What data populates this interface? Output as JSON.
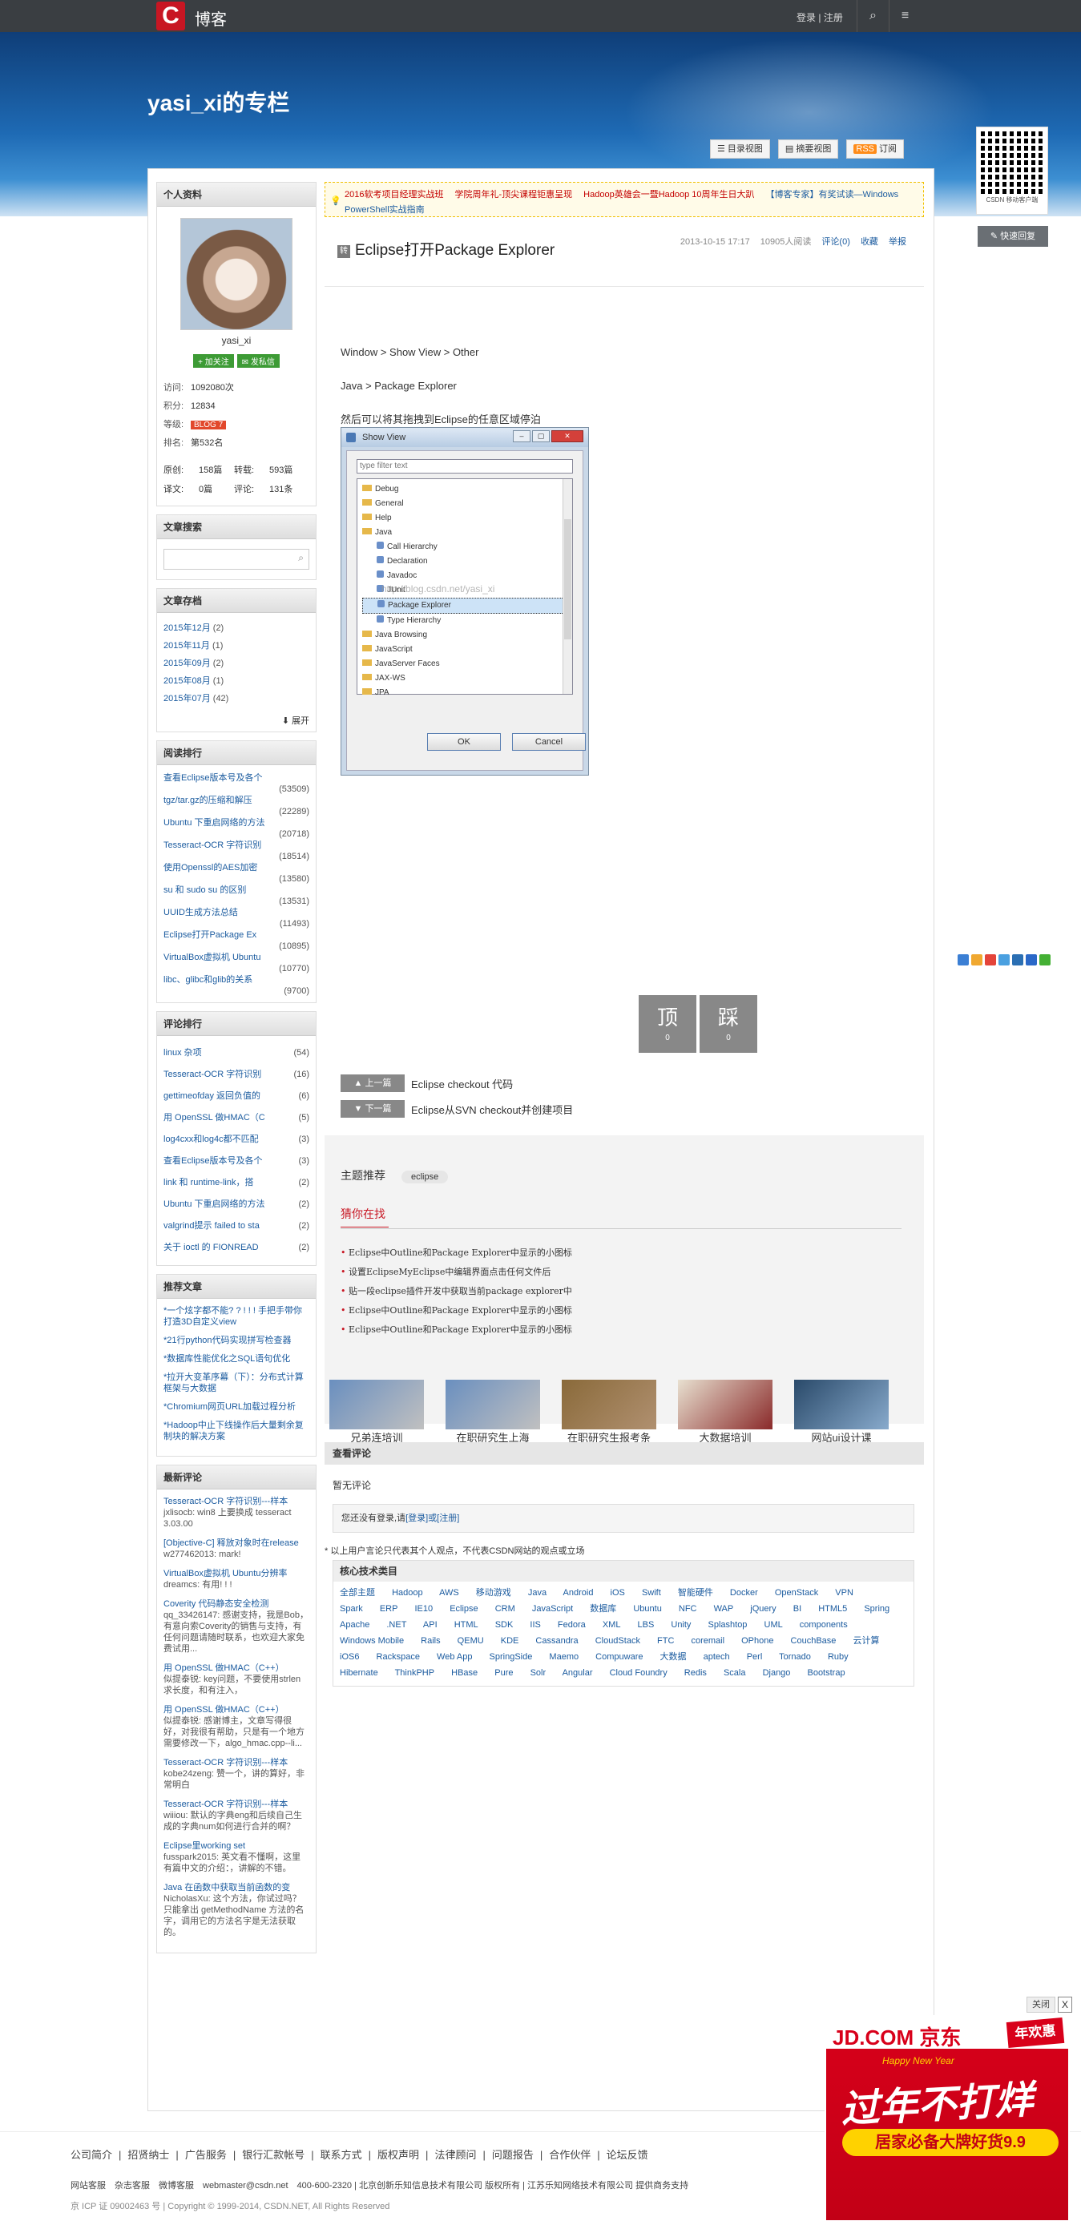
{
  "topbar": {
    "brand": "博客",
    "login": "登录",
    "sep": "|",
    "register": "注册"
  },
  "blog_title": "yasi_xi的专栏",
  "views": {
    "catalog": "目录视图",
    "summary": "摘要视图",
    "rss": "RSS",
    "subscribe": "订阅"
  },
  "qr_label": "CSDN 移动客户端",
  "quick_reply": "快速回复",
  "profile": {
    "heading": "个人资料",
    "name": "yasi_xi",
    "follow": "+ 加关注",
    "message": "✉ 发私信",
    "visits_label": "访问:",
    "visits": "1092080次",
    "points_label": "积分:",
    "points": "12834",
    "level_label": "等级:",
    "level": "BLOG 7",
    "rank_label": "排名:",
    "rank": "第532名",
    "orig_label": "原创:",
    "orig": "158篇",
    "repost_label": "转载:",
    "repost": "593篇",
    "trans_label": "译文:",
    "trans": "0篇",
    "comments_label": "评论:",
    "comments": "131条"
  },
  "search": {
    "heading": "文章搜索"
  },
  "archive": {
    "heading": "文章存档",
    "items": [
      {
        "m": "2015年12月",
        "c": "(2)"
      },
      {
        "m": "2015年11月",
        "c": "(1)"
      },
      {
        "m": "2015年09月",
        "c": "(2)"
      },
      {
        "m": "2015年08月",
        "c": "(1)"
      },
      {
        "m": "2015年07月",
        "c": "(42)"
      }
    ],
    "expand": "展开"
  },
  "read_rank": {
    "heading": "阅读排行",
    "items": [
      {
        "t": "查看Eclipse版本号及各个",
        "c": "(53509)"
      },
      {
        "t": "tgz/tar.gz的压缩和解压",
        "c": "(22289)"
      },
      {
        "t": "Ubuntu 下重启网络的方法",
        "c": "(20718)"
      },
      {
        "t": "Tesseract-OCR 字符识别",
        "c": "(18514)"
      },
      {
        "t": "使用Openssl的AES加密",
        "c": "(13580)"
      },
      {
        "t": "su 和 sudo su 的区别",
        "c": "(13531)"
      },
      {
        "t": "UUID生成方法总结",
        "c": "(11493)"
      },
      {
        "t": "Eclipse打开Package Ex",
        "c": "(10895)"
      },
      {
        "t": "VirtualBox虚拟机 Ubuntu",
        "c": "(10770)"
      },
      {
        "t": "libc、glibc和glib的关系",
        "c": "(9700)"
      }
    ]
  },
  "comment_rank": {
    "heading": "评论排行",
    "items": [
      {
        "t": "linux 杂项",
        "c": "(54)"
      },
      {
        "t": "Tesseract-OCR 字符识别",
        "c": "(16)"
      },
      {
        "t": "gettimeofday 返回负值的",
        "c": "(6)"
      },
      {
        "t": "用 OpenSSL 做HMAC（C",
        "c": "(5)"
      },
      {
        "t": "log4cxx和log4c都不匹配",
        "c": "(3)"
      },
      {
        "t": "查看Eclipse版本号及各个",
        "c": "(3)"
      },
      {
        "t": "link 和 runtime-link，搭",
        "c": "(2)"
      },
      {
        "t": "Ubuntu 下重启网络的方法",
        "c": "(2)"
      },
      {
        "t": "valgrind提示 failed to sta",
        "c": "(2)"
      },
      {
        "t": "关于 ioctl 的 FIONREAD",
        "c": "(2)"
      }
    ]
  },
  "recommend": {
    "heading": "推荐文章",
    "items": [
      "*一个炫字都不能? ? ! ! ! 手把手带你打造3D自定义view",
      "*21行python代码实现拼写检查器",
      "*数据库性能优化之SQL语句优化",
      "*拉开大变革序幕（下）：分布式计算框架与大数据",
      "*Chromium网页URL加载过程分析",
      "*Hadoop中止下线操作后大量剩余复制块的解决方案"
    ]
  },
  "latest_comments": {
    "heading": "最新评论",
    "items": [
      {
        "t": "Tesseract-OCR 字符识别---样本",
        "b": "jxlisocb: win8 上要换成 tesseract 3.03.00"
      },
      {
        "t": "[Objective-C] 释放对象时在release",
        "b": "w277462013: mark!"
      },
      {
        "t": "VirtualBox虚拟机 Ubuntu分辨率",
        "b": "dreamcs: 有用! ! !"
      },
      {
        "t": "Coverity 代码静态安全检测",
        "b": "qq_33426147: 感谢支持，我是Bob，有意向索Coverity的销售与支持，有任何问题请随时联系，也欢迎大家免费试用..."
      },
      {
        "t": "用 OpenSSL 做HMAC（C++）",
        "b": "似提泰锐: key问题，不要使用strlen求长度，和有注入，"
      },
      {
        "t": "用 OpenSSL 做HMAC（C++）",
        "b": "似提泰锐: 感谢博主，文章写得很好，对我很有帮助，只是有一个地方需要修改一下，algo_hmac.cpp--li..."
      },
      {
        "t": "Tesseract-OCR 字符识别---样本",
        "b": "kobe24zeng: 赞一个，讲的算好，非常明白"
      },
      {
        "t": "Tesseract-OCR 字符识别---样本",
        "b": "wiiiou: 默认的字典eng和后续自己生成的字典num如何进行合并的啊？"
      },
      {
        "t": "Eclipse里working set",
        "b": "fusspark2015: 英文看不懂啊，这里有篇中文的介绍：，讲解的不错。"
      },
      {
        "t": "Java 在函数中获取当前函数的变",
        "b": "NicholasXu: 这个方法，你试过吗？只能拿出 getMethodName 方法的名字，调用它的方法名字是无法获取的。"
      }
    ]
  },
  "notice": [
    {
      "t": "2016软考项目经理实战班",
      "blue": false
    },
    {
      "t": "学院周年礼-顶尖课程钜惠呈现",
      "blue": false
    },
    {
      "t": "Hadoop英雄会一暨Hadoop 10周年生日大趴",
      "blue": false
    },
    {
      "t": "【博客专家】有奖试读—Windows PowerShell实战指南",
      "blue": true
    }
  ],
  "article": {
    "zhuan": "转",
    "title": "Eclipse打开Package Explorer",
    "date": "2013-10-15 17:17",
    "reads": "10905人阅读",
    "comment": "评论(0)",
    "collect": "收藏",
    "report": "举报",
    "lines": [
      "Window > Show View > Other",
      "Java > Package Explorer",
      "然后可以将其拖拽到Eclipse的任意区域停泊"
    ]
  },
  "dialog": {
    "title": "Show View",
    "filter": "type filter text",
    "items": [
      {
        "t": "Debug",
        "k": "folder"
      },
      {
        "t": "General",
        "k": "folder"
      },
      {
        "t": "Help",
        "k": "folder"
      },
      {
        "t": "Java",
        "k": "folder"
      },
      {
        "t": "Call Hierarchy",
        "k": "leaf"
      },
      {
        "t": "Declaration",
        "k": "leaf"
      },
      {
        "t": "Javadoc",
        "k": "leaf"
      },
      {
        "t": "JUnit",
        "k": "leaf"
      },
      {
        "t": "Package Explorer",
        "k": "sel"
      },
      {
        "t": "Type Hierarchy",
        "k": "leaf"
      },
      {
        "t": "Java Browsing",
        "k": "folder"
      },
      {
        "t": "JavaScript",
        "k": "folder"
      },
      {
        "t": "JavaServer Faces",
        "k": "folder"
      },
      {
        "t": "JAX-WS",
        "k": "folder"
      },
      {
        "t": "JPA",
        "k": "folder"
      }
    ],
    "watermark": "http://blog.csdn.net/yasi_xi",
    "ok": "OK",
    "cancel": "Cancel"
  },
  "votes": {
    "up": "顶",
    "up_count": "0",
    "down": "踩",
    "down_count": "0"
  },
  "prev": {
    "label": "上一篇",
    "title": "Eclipse checkout 代码"
  },
  "next": {
    "label": "下一篇",
    "title": "Eclipse从SVN checkout并创建项目"
  },
  "topic": {
    "label": "主题推荐",
    "tag": "eclipse"
  },
  "guess": {
    "heading": "猜你在找",
    "items": [
      "Eclipse中Outline和Package Explorer中显示的小图标",
      "设置EclipseMyEclipse中编辑界面点击任何文件后",
      "贴一段eclipse插件开发中获取当前package explorer中",
      "Eclipse中Outline和Package Explorer中显示的小图标",
      "Eclipse中Outline和Package Explorer中显示的小图标"
    ]
  },
  "ads": [
    "兄弟连培训",
    "在职研究生上海",
    "在职研究生报考条",
    "大数据培训",
    "网站ui设计课"
  ],
  "view_comments": "查看评论",
  "no_comments": "暂无评论",
  "login_box": {
    "pre": "您还没有登录,请",
    "link": "[登录]或[注册]"
  },
  "disclaimer": "* 以上用户言论只代表其个人观点，不代表CSDN网站的观点或立场",
  "tech": {
    "heading": "核心技术类目",
    "items": [
      "全部主题",
      "Hadoop",
      "AWS",
      "移动游戏",
      "Java",
      "Android",
      "iOS",
      "Swift",
      "智能硬件",
      "Docker",
      "OpenStack",
      "VPN",
      "Spark",
      "ERP",
      "IE10",
      "Eclipse",
      "CRM",
      "JavaScript",
      "数据库",
      "Ubuntu",
      "NFC",
      "WAP",
      "jQuery",
      "BI",
      "HTML5",
      "Spring",
      "Apache",
      ".NET",
      "API",
      "HTML",
      "SDK",
      "IIS",
      "Fedora",
      "XML",
      "LBS",
      "Unity",
      "Splashtop",
      "UML",
      "components",
      "Windows Mobile",
      "Rails",
      "QEMU",
      "KDE",
      "Cassandra",
      "CloudStack",
      "FTC",
      "coremail",
      "OPhone",
      "CouchBase",
      "云计算",
      "iOS6",
      "Rackspace",
      "Web App",
      "SpringSide",
      "Maemo",
      "Compuware",
      "大数据",
      "aptech",
      "Perl",
      "Tornado",
      "Ruby",
      "Hibernate",
      "ThinkPHP",
      "HBase",
      "Pure",
      "Solr",
      "Angular",
      "Cloud Foundry",
      "Redis",
      "Scala",
      "Django",
      "Bootstrap"
    ]
  },
  "footer": {
    "links": [
      "公司简介",
      "招贤纳士",
      "广告服务",
      "银行汇款帐号",
      "联系方式",
      "版权声明",
      "法律顾问",
      "问题报告",
      "合作伙伴",
      "论坛反馈"
    ],
    "line2": "网站客服　杂志客服　微博客服　webmaster@csdn.net　400-600-2320 | 北京创新乐知信息技术有限公司 版权所有 | 江苏乐知网络技术有限公司 提供商务支持",
    "line3": "京 ICP 证 09002463 号 | Copyright © 1999-2014, CSDN.NET, All Rights Reserved"
  },
  "jd_ad": {
    "logo": "JD.COM 京东",
    "nian": "年欢惠",
    "happy": "Happy New Year",
    "big": "过年不打烊",
    "sub": "居家必备大牌好货9.9",
    "close": "关闭",
    "x": "X"
  }
}
